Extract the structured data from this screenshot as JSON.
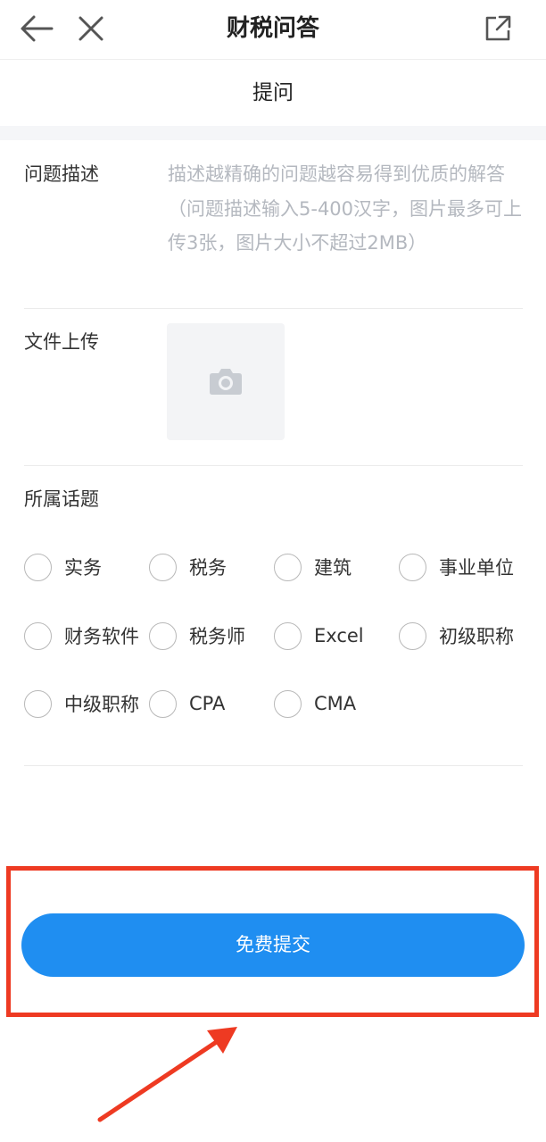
{
  "header": {
    "title": "财税问答",
    "back_icon": "arrow-left-icon",
    "close_icon": "close-icon",
    "share_icon": "external-link-icon"
  },
  "tab": {
    "label": "提问"
  },
  "form": {
    "description_label": "问题描述",
    "description_placeholder": "描述越精确的问题越容易得到优质的解答（问题描述输入5-400汉字，图片最多可上传3张，图片大小不超过2MB）",
    "upload_label": "文件上传",
    "upload_icon": "camera-icon",
    "topic_label": "所属话题",
    "topics": [
      "实务",
      "税务",
      "建筑",
      "事业单位",
      "财务软件",
      "税务师",
      "Excel",
      "初级职称",
      "中级职称",
      "CPA",
      "CMA"
    ]
  },
  "submit": {
    "label": "免费提交"
  },
  "colors": {
    "primary": "#1f8ef1",
    "annotation_red": "#ee3a22",
    "placeholder": "#b4b8bf"
  }
}
